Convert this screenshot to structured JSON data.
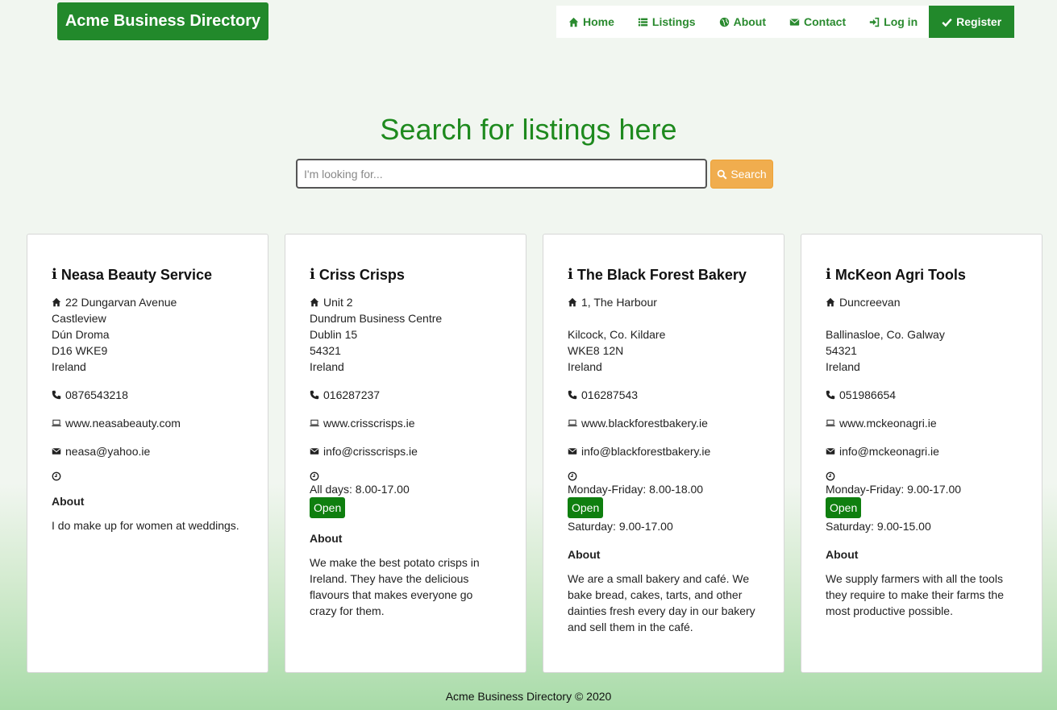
{
  "brand": {
    "title": "Acme Business Directory"
  },
  "nav": {
    "items": [
      {
        "label": "Home",
        "icon": "home-icon"
      },
      {
        "label": "Listings",
        "icon": "list-icon"
      },
      {
        "label": "About",
        "icon": "globe-icon"
      },
      {
        "label": "Contact",
        "icon": "envelope-icon"
      },
      {
        "label": "Log in",
        "icon": "sign-in-icon"
      },
      {
        "label": "Register",
        "icon": "check-icon"
      }
    ]
  },
  "hero": {
    "title": "Search for listings here"
  },
  "search": {
    "placeholder": "I'm looking for...",
    "value": "",
    "button_label": "Search"
  },
  "about_heading": "About",
  "listings": [
    {
      "name": "Neasa Beauty Service",
      "address": [
        "22 Dungarvan Avenue",
        "Castleview",
        "Dún Droma",
        "D16 WKE9",
        "Ireland"
      ],
      "phone": "0876543218",
      "website": "www.neasabeauty.com",
      "email": "neasa@yahoo.ie",
      "hours": [],
      "open_badge": "",
      "about": "I do make up for women at weddings."
    },
    {
      "name": "Criss Crisps",
      "address": [
        "Unit 2",
        "Dundrum Business Centre",
        "Dublin 15",
        "54321",
        "Ireland"
      ],
      "phone": "016287237",
      "website": "www.crisscrisps.ie",
      "email": "info@crisscrisps.ie",
      "hours": [
        "All days: 8.00-17.00"
      ],
      "open_badge": "Open",
      "about": "We make the best potato crisps in Ireland. They have the delicious flavours that makes everyone go crazy for them."
    },
    {
      "name": "The Black Forest Bakery",
      "address": [
        "1, The Harbour",
        "",
        "Kilcock, Co. Kildare",
        "WKE8 12N",
        "Ireland"
      ],
      "phone": "016287543",
      "website": "www.blackforestbakery.ie",
      "email": "info@blackforestbakery.ie",
      "hours": [
        "Monday-Friday: 8.00-18.00",
        "Saturday: 9.00-17.00"
      ],
      "open_badge": "Open",
      "about": "We are a small bakery and café. We bake bread, cakes, tarts, and other dainties fresh every day in our bakery and sell them in the café."
    },
    {
      "name": "McKeon Agri Tools",
      "address": [
        "Duncreevan",
        "",
        "Ballinasloe, Co. Galway",
        "54321",
        "Ireland"
      ],
      "phone": "051986654",
      "website": "www.mckeonagri.ie",
      "email": "info@mckeonagri.ie",
      "hours": [
        "Monday-Friday: 9.00-17.00",
        "Saturday: 9.00-15.00"
      ],
      "open_badge": "Open",
      "about": "We supply farmers with all the tools they require to make their farms the most productive possible."
    }
  ],
  "footer": {
    "text": "Acme Business Directory © 2020"
  },
  "colors": {
    "brand_green": "#22892b",
    "title_green": "#1e8a1e",
    "badge_green": "#0f7f0f",
    "search_orange": "#f0ad4e"
  }
}
